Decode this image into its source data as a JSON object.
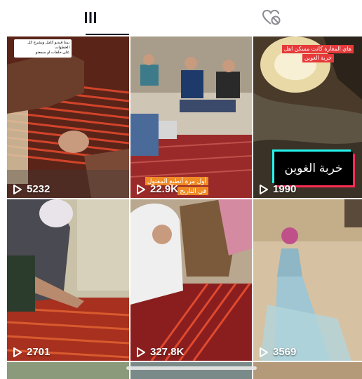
{
  "tabs": [
    {
      "icon": "grid-icon",
      "active": true
    },
    {
      "icon": "liked-hidden-icon",
      "active": false
    }
  ],
  "videos": [
    {
      "views": "5232",
      "caption_lines": [
        "بيننا فيديو كامل ويشرح كل",
        "الخطوات",
        "على حلقات او سمعتو"
      ]
    },
    {
      "views": "22.9K",
      "caption_lines": [
        "أول مرة أنطبع المفتول",
        "في التاريخ"
      ]
    },
    {
      "views": "1990",
      "caption_lines": [
        "هاي المغارة كانت مسكن اهل",
        "خربة الغوين"
      ],
      "title_card": "خربة الغوين"
    },
    {
      "views": "2701"
    },
    {
      "views": "327.8K"
    },
    {
      "views": "3569"
    }
  ],
  "colors": {
    "accent_orange": "#f08a24",
    "caption_red": "#e63a3a",
    "title_card_cyan": "#25f4ee",
    "title_card_pink": "#fe2c55"
  }
}
